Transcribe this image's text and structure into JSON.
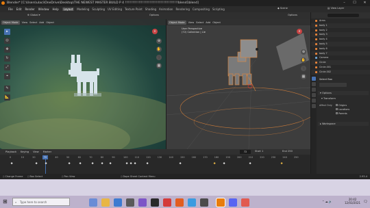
{
  "titlebar": {
    "title": "Blender* [C:\\Users\\ulaci\\OneDrive\\Desktop\\THE NEWEST MASTER BUILD P 4 !!!!!!!!!!!!!!!!!!!!!!!!!!!!!!!!!!!!!!!!!!!blend1blend]"
  },
  "menu": {
    "items": [
      "File",
      "Edit",
      "Render",
      "Window",
      "Help"
    ],
    "workspaces": [
      "Layout",
      "Modeling",
      "Sculpting",
      "UV Editing",
      "Texture Paint",
      "Shading",
      "Animation",
      "Rendering",
      "Compositing",
      "Scripting"
    ],
    "active_workspace": "Layout",
    "scene": "Scene",
    "view_layer": "View Layer"
  },
  "vp1": {
    "mode": "Object Mode",
    "menus": [
      "View",
      "Select",
      "Add",
      "Object"
    ],
    "transform": "Global",
    "options": "Options"
  },
  "vp2": {
    "mode": "Object Mode",
    "menus": [
      "View",
      "Select",
      "Add",
      "Object"
    ],
    "transform": "Global",
    "options": "Options",
    "info_line1": "User Perspective",
    "info_line2": "(72) Collection | Lie"
  },
  "outliner": {
    "items": [
      "Arms",
      "body 1",
      "body 2",
      "body 3",
      "body 4",
      "body 5",
      "body 6",
      "body 7",
      "Camera",
      "Circle",
      "Circle.001",
      "Circle.002"
    ]
  },
  "props": {
    "tool": "Select Box",
    "options": "Options",
    "transform": "Transform",
    "affect_only": "Affect Only",
    "origins": "Origins",
    "locations": "Locations",
    "parents": "Parents",
    "workspace": "Workspace"
  },
  "timeline": {
    "menus": [
      "Playback",
      "Keying",
      "View",
      "Marker"
    ],
    "current_frame": "72",
    "start_label": "Start",
    "start": "1",
    "end_label": "End",
    "end": "250",
    "ticks": [
      "0",
      "10",
      "20",
      "30",
      "40",
      "50",
      "60",
      "70",
      "80",
      "90",
      "100",
      "110",
      "120",
      "130",
      "140",
      "150",
      "160",
      "170",
      "180",
      "190",
      "200",
      "210",
      "220",
      "230",
      "240",
      "250"
    ]
  },
  "status": {
    "left1": "Change Frame",
    "left2": "Box Select",
    "left3": "Pan View",
    "mid": "Dope Sheet Context Menu",
    "version": "2.93.4"
  },
  "taskbar": {
    "search": "Type here to search",
    "time": "20:42",
    "date": "12/03/2021"
  }
}
